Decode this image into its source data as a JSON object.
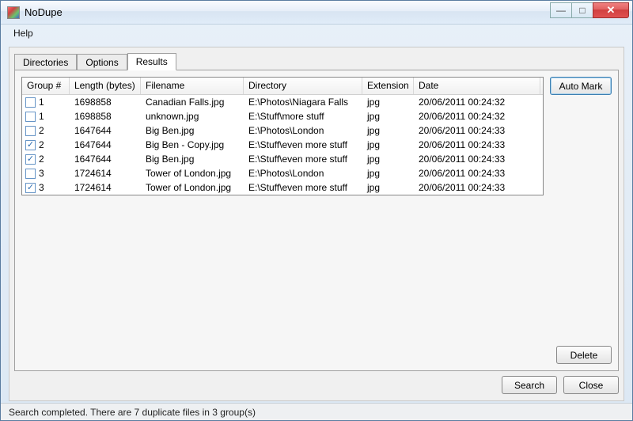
{
  "window": {
    "title": "NoDupe"
  },
  "menu": {
    "help": "Help"
  },
  "tabs": {
    "directories": "Directories",
    "options": "Options",
    "results": "Results"
  },
  "columns": {
    "group": "Group #",
    "length": "Length (bytes)",
    "filename": "Filename",
    "directory": "Directory",
    "extension": "Extension",
    "date": "Date"
  },
  "rows": [
    {
      "checked": false,
      "group": "1",
      "length": "1698858",
      "filename": "Canadian Falls.jpg",
      "directory": "E:\\Photos\\Niagara Falls",
      "extension": "jpg",
      "date": "20/06/2011 00:24:32"
    },
    {
      "checked": false,
      "group": "1",
      "length": "1698858",
      "filename": "unknown.jpg",
      "directory": "E:\\Stuff\\more stuff",
      "extension": "jpg",
      "date": "20/06/2011 00:24:32"
    },
    {
      "checked": false,
      "group": "2",
      "length": "1647644",
      "filename": "Big Ben.jpg",
      "directory": "E:\\Photos\\London",
      "extension": "jpg",
      "date": "20/06/2011 00:24:33"
    },
    {
      "checked": true,
      "group": "2",
      "length": "1647644",
      "filename": "Big Ben - Copy.jpg",
      "directory": "E:\\Stuff\\even more stuff",
      "extension": "jpg",
      "date": "20/06/2011 00:24:33"
    },
    {
      "checked": true,
      "group": "2",
      "length": "1647644",
      "filename": "Big Ben.jpg",
      "directory": "E:\\Stuff\\even more stuff",
      "extension": "jpg",
      "date": "20/06/2011 00:24:33"
    },
    {
      "checked": false,
      "group": "3",
      "length": "1724614",
      "filename": "Tower of London.jpg",
      "directory": "E:\\Photos\\London",
      "extension": "jpg",
      "date": "20/06/2011 00:24:33"
    },
    {
      "checked": true,
      "group": "3",
      "length": "1724614",
      "filename": "Tower of London.jpg",
      "directory": "E:\\Stuff\\even more stuff",
      "extension": "jpg",
      "date": "20/06/2011 00:24:33"
    }
  ],
  "buttons": {
    "auto_mark": "Auto Mark",
    "delete": "Delete",
    "search": "Search",
    "close": "Close"
  },
  "status": "Search completed. There are 7 duplicate files in 3 group(s)"
}
